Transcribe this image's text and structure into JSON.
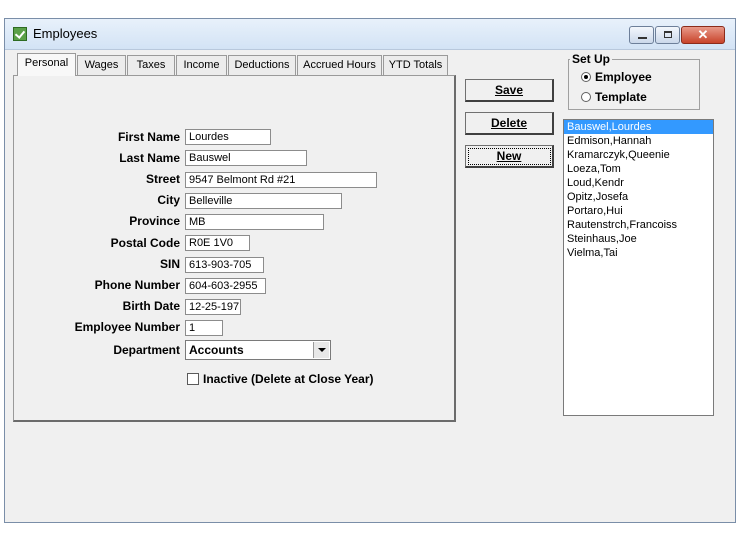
{
  "window": {
    "title": "Employees",
    "close_glyph": "✕"
  },
  "tabs": [
    "Personal",
    "Wages",
    "Taxes",
    "Income",
    "Deductions",
    "Accrued Hours",
    "YTD Totals"
  ],
  "fields": {
    "first_name": {
      "label": "First Name",
      "value": "Lourdes"
    },
    "last_name": {
      "label": "Last Name",
      "value": "Bauswel"
    },
    "street": {
      "label": "Street",
      "value": "9547 Belmont Rd #21"
    },
    "city": {
      "label": "City",
      "value": "Belleville"
    },
    "province": {
      "label": "Province",
      "value": "MB"
    },
    "postal_code": {
      "label": "Postal Code",
      "value": "R0E 1V0"
    },
    "sin": {
      "label": "SIN",
      "value": "613-903-705"
    },
    "phone": {
      "label": "Phone Number",
      "value": "604-603-2955"
    },
    "birth_date": {
      "label": "Birth Date",
      "value": "12-25-197"
    },
    "employee_number": {
      "label": "Employee Number",
      "value": "1"
    },
    "department": {
      "label": "Department",
      "value": "Accounts"
    }
  },
  "inactive_checkbox": {
    "label": "Inactive (Delete at Close Year)",
    "checked": false
  },
  "buttons": {
    "save": "Save",
    "delete": "Delete",
    "new": "New"
  },
  "setup": {
    "legend": "Set Up",
    "employee": "Employee",
    "template": "Template",
    "selected": "Employee"
  },
  "employees": [
    "Bauswel,Lourdes",
    "Edmison,Hannah",
    "Kramarczyk,Queenie",
    "Loeza,Tom",
    "Loud,Kendr",
    "Opitz,Josefa",
    "Portaro,Hui",
    "Rautenstrch,Francoiss",
    "Steinhaus,Joe",
    "Vielma,Tai"
  ],
  "selected_employee": "Bauswel,Lourdes",
  "colors": {
    "selection": "#3399ff",
    "window_bg": "#f0f0f0"
  },
  "icons": {
    "app": "employees-app-icon",
    "minimize": "minimize-icon",
    "maximize": "maximize-icon",
    "close": "close-icon",
    "dropdown": "chevron-down-icon"
  }
}
